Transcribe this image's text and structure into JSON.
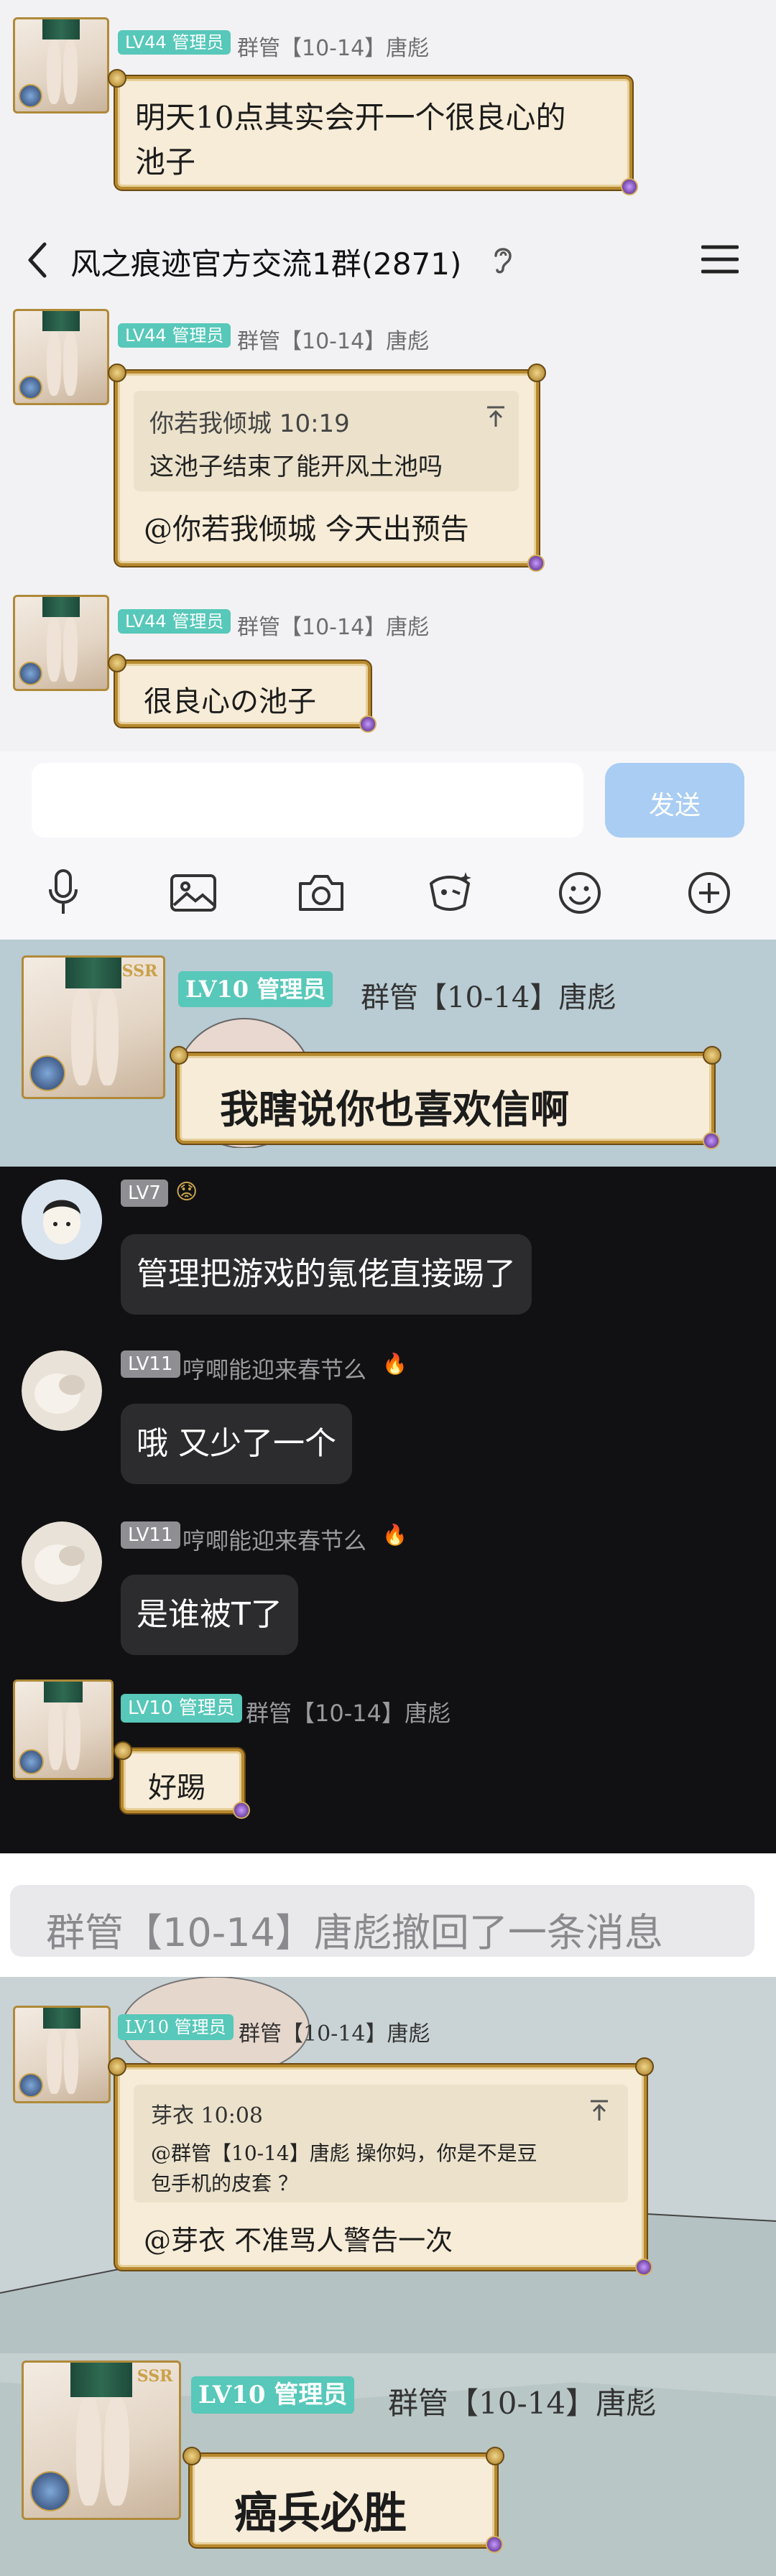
{
  "panel1": {
    "level": "LV44 管理员",
    "sender": "群管【10-14】唐彪",
    "message_line1": "明天10点其实会开一个很良心的",
    "message_line2": "池子"
  },
  "panel2": {
    "header": {
      "back_icon": "chevron-left-icon",
      "title": "风之痕迹官方交流1群(2871)",
      "ear_icon": "ear-icon",
      "menu_icon": "hamburger-menu-icon"
    },
    "messages": [
      {
        "level": "LV44 管理员",
        "sender": "群管【10-14】唐彪",
        "quote_author_time": "你若我倾城 10:19",
        "quote_text": "这池子结束了能开风土池吗",
        "reply": "@你若我倾城  今天出预告"
      },
      {
        "level": "LV44 管理员",
        "sender": "群管【10-14】唐彪",
        "reply": "很良心の池子"
      }
    ],
    "input": {
      "placeholder": "",
      "send_label": "发送"
    },
    "toolbar": [
      "microphone-icon",
      "image-icon",
      "camera-icon",
      "magic-icon",
      "emoji-icon",
      "plus-icon"
    ],
    "colors": {
      "send_button": "#a9cdf3",
      "accent": "#57c8b9"
    }
  },
  "panel3": {
    "level": "LV10 管理员",
    "sender": "群管【10-14】唐彪",
    "message": "我瞎说你也喜欢信啊",
    "ssr": "SSR"
  },
  "panel4": {
    "messages": [
      {
        "level": "LV7",
        "name": "",
        "emoji": "😟",
        "text": "管理把游戏的氪佬直接踢了"
      },
      {
        "level": "LV11",
        "name": "哼唧能迎来春节么",
        "emoji": "🔥",
        "text": "哦 又少了一个"
      },
      {
        "level": "LV11",
        "name": "哼唧能迎来春节么",
        "emoji": "🔥",
        "text": "是谁被T了"
      },
      {
        "level": "LV10 管理员",
        "name": "群管【10-14】唐彪",
        "emoji": "",
        "text": "好踢"
      }
    ]
  },
  "panel5": {
    "recall_notice": "群管【10-14】唐彪撤回了一条消息"
  },
  "panel6": {
    "level": "LV10 管理员",
    "sender": "群管【10-14】唐彪",
    "quote_author_time": "芽衣 10:08",
    "quote_line1": "@群管【10-14】唐彪 操你妈，你是不是豆",
    "quote_line2": "包手机的皮套 ？",
    "reply": "@芽衣  不准骂人警告一次"
  },
  "panel7": {
    "level": "LV10 管理员",
    "sender": "群管【10-14】唐彪",
    "message": "癌兵必胜",
    "ssr": "SSR"
  }
}
